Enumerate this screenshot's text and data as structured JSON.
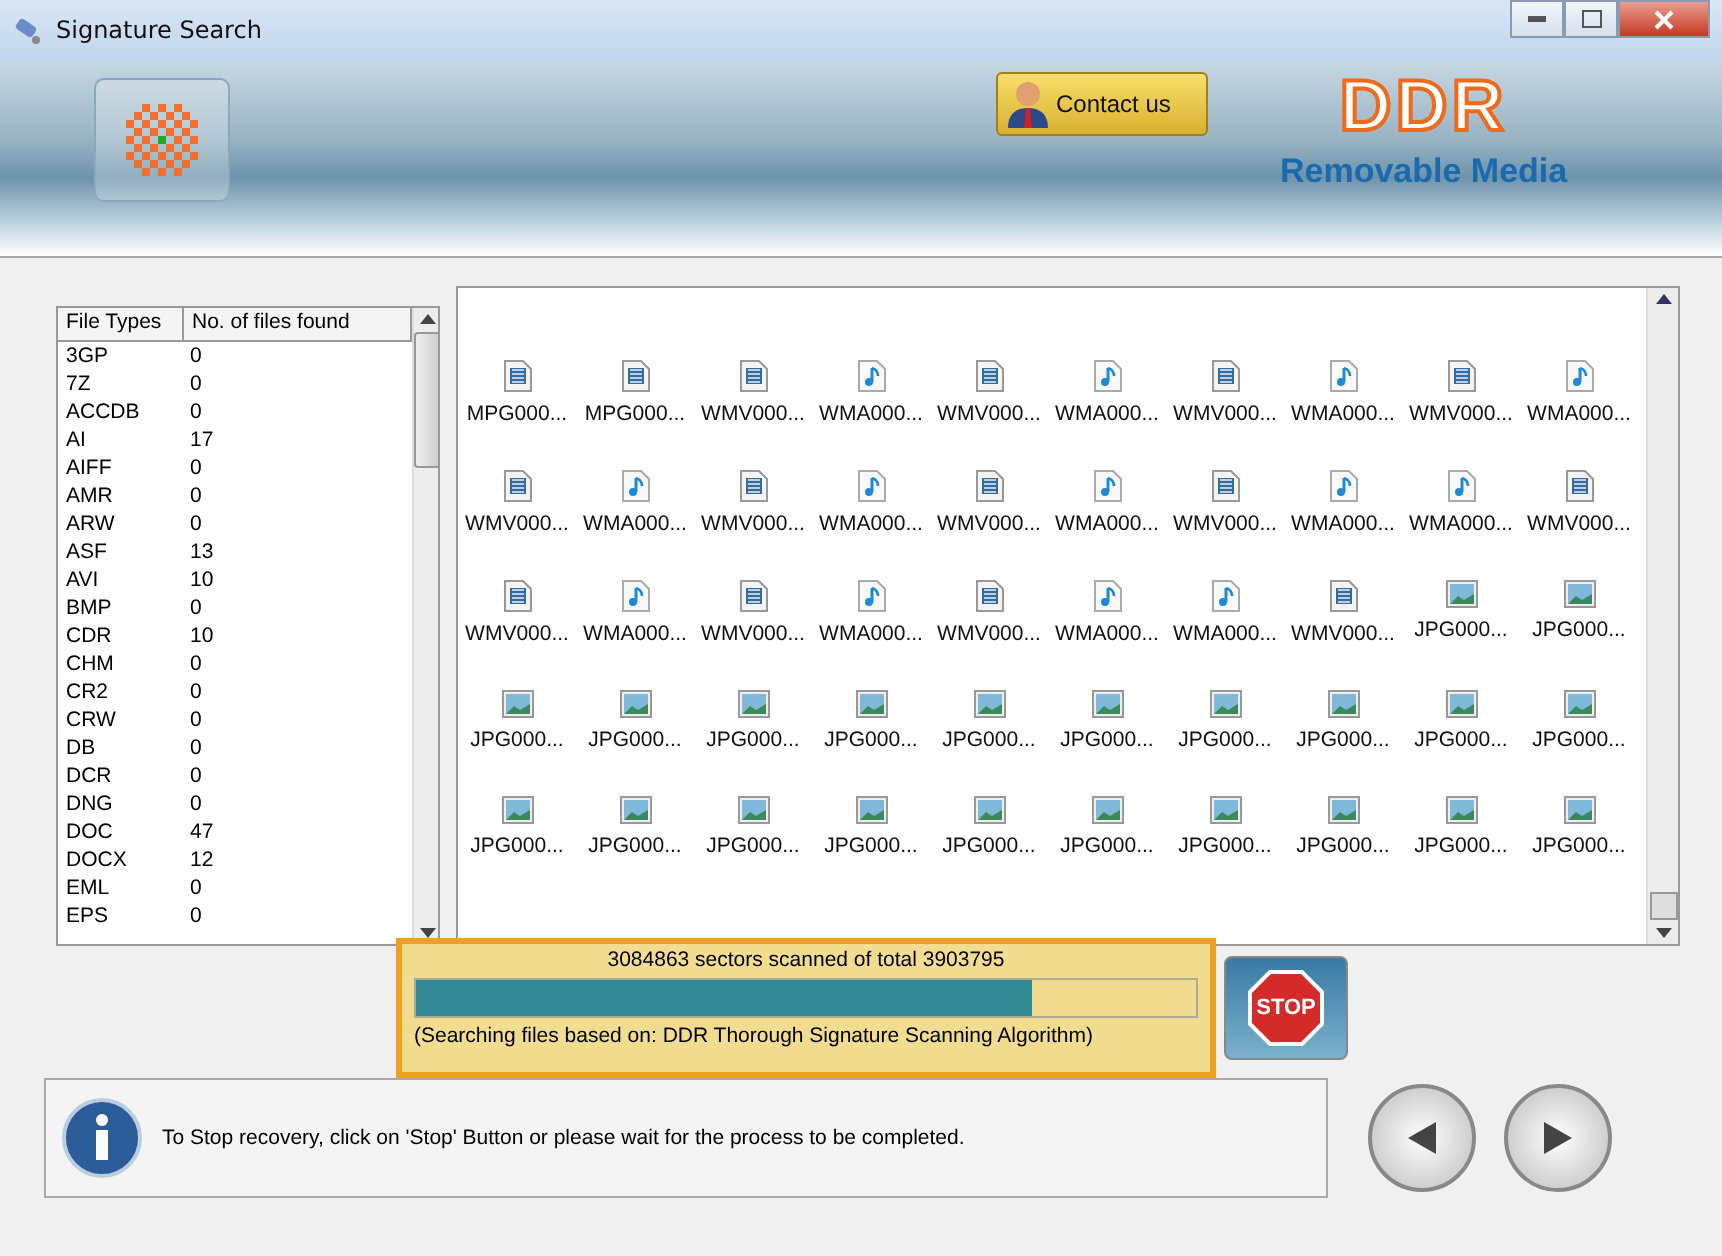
{
  "window": {
    "title": "Signature Search"
  },
  "header": {
    "contact_button": "Contact us",
    "brand": "DDR",
    "product": "Removable Media"
  },
  "file_types": {
    "columns": [
      "File Types",
      "No. of files found"
    ],
    "rows": [
      [
        "3GP",
        "0"
      ],
      [
        "7Z",
        "0"
      ],
      [
        "ACCDB",
        "0"
      ],
      [
        "AI",
        "17"
      ],
      [
        "AIFF",
        "0"
      ],
      [
        "AMR",
        "0"
      ],
      [
        "ARW",
        "0"
      ],
      [
        "ASF",
        "13"
      ],
      [
        "AVI",
        "10"
      ],
      [
        "BMP",
        "0"
      ],
      [
        "CDR",
        "10"
      ],
      [
        "CHM",
        "0"
      ],
      [
        "CR2",
        "0"
      ],
      [
        "CRW",
        "0"
      ],
      [
        "DB",
        "0"
      ],
      [
        "DCR",
        "0"
      ],
      [
        "DNG",
        "0"
      ],
      [
        "DOC",
        "47"
      ],
      [
        "DOCX",
        "12"
      ],
      [
        "EML",
        "0"
      ],
      [
        "EPS",
        "0"
      ]
    ]
  },
  "files": [
    [
      {
        "label": "MPG000...",
        "kind": "video"
      },
      {
        "label": "MPG000...",
        "kind": "video"
      },
      {
        "label": "WMV000...",
        "kind": "video"
      },
      {
        "label": "WMA000...",
        "kind": "audio"
      },
      {
        "label": "WMV000...",
        "kind": "video"
      },
      {
        "label": "WMA000...",
        "kind": "audio"
      },
      {
        "label": "WMV000...",
        "kind": "video"
      },
      {
        "label": "WMA000...",
        "kind": "audio"
      },
      {
        "label": "WMV000...",
        "kind": "video"
      },
      {
        "label": "WMA000...",
        "kind": "audio"
      }
    ],
    [
      {
        "label": "WMV000...",
        "kind": "video"
      },
      {
        "label": "WMA000...",
        "kind": "audio"
      },
      {
        "label": "WMV000...",
        "kind": "video"
      },
      {
        "label": "WMA000...",
        "kind": "audio"
      },
      {
        "label": "WMV000...",
        "kind": "video"
      },
      {
        "label": "WMA000...",
        "kind": "audio"
      },
      {
        "label": "WMV000...",
        "kind": "video"
      },
      {
        "label": "WMA000...",
        "kind": "audio"
      },
      {
        "label": "WMA000...",
        "kind": "audio"
      },
      {
        "label": "WMV000...",
        "kind": "video"
      }
    ],
    [
      {
        "label": "WMV000...",
        "kind": "video"
      },
      {
        "label": "WMA000...",
        "kind": "audio"
      },
      {
        "label": "WMV000...",
        "kind": "video"
      },
      {
        "label": "WMA000...",
        "kind": "audio"
      },
      {
        "label": "WMV000...",
        "kind": "video"
      },
      {
        "label": "WMA000...",
        "kind": "audio"
      },
      {
        "label": "WMA000...",
        "kind": "audio"
      },
      {
        "label": "WMV000...",
        "kind": "video"
      },
      {
        "label": "JPG000...",
        "kind": "image"
      },
      {
        "label": "JPG000...",
        "kind": "image"
      }
    ],
    [
      {
        "label": "JPG000...",
        "kind": "image"
      },
      {
        "label": "JPG000...",
        "kind": "image"
      },
      {
        "label": "JPG000...",
        "kind": "image"
      },
      {
        "label": "JPG000...",
        "kind": "image"
      },
      {
        "label": "JPG000...",
        "kind": "image"
      },
      {
        "label": "JPG000...",
        "kind": "image"
      },
      {
        "label": "JPG000...",
        "kind": "image"
      },
      {
        "label": "JPG000...",
        "kind": "image"
      },
      {
        "label": "JPG000...",
        "kind": "image"
      },
      {
        "label": "JPG000...",
        "kind": "image"
      }
    ],
    [
      {
        "label": "JPG000...",
        "kind": "image"
      },
      {
        "label": "JPG000...",
        "kind": "image"
      },
      {
        "label": "JPG000...",
        "kind": "image"
      },
      {
        "label": "JPG000...",
        "kind": "image"
      },
      {
        "label": "JPG000...",
        "kind": "image"
      },
      {
        "label": "JPG000...",
        "kind": "image"
      },
      {
        "label": "JPG000...",
        "kind": "image"
      },
      {
        "label": "JPG000...",
        "kind": "image"
      },
      {
        "label": "JPG000...",
        "kind": "image"
      },
      {
        "label": "JPG000...",
        "kind": "image"
      }
    ]
  ],
  "progress": {
    "status": "3084863 sectors scanned of total 3903795",
    "level": 0.79,
    "note": "(Searching files based on:  DDR Thorough Signature Scanning Algorithm)",
    "stop_button": "STOP"
  },
  "info": {
    "message": "To Stop recovery, click on 'Stop' Button or please wait for the process to be completed."
  }
}
